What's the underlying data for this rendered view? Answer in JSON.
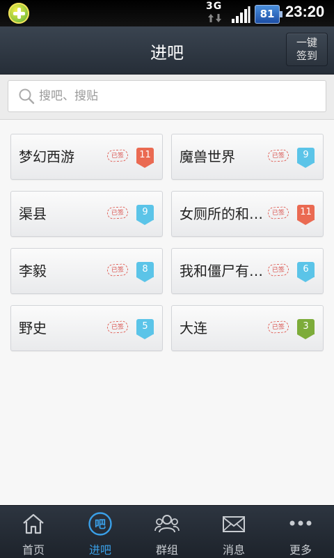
{
  "status_bar": {
    "network": "3G",
    "battery": "81",
    "time": "23:20"
  },
  "header": {
    "title": "进吧",
    "signin_line1": "一键",
    "signin_line2": "签到"
  },
  "search": {
    "placeholder": "搜吧、搜贴"
  },
  "stamp_text": "已签",
  "forums": [
    {
      "name": "梦幻西游",
      "level": "11",
      "badge_color": "#ea6a52"
    },
    {
      "name": "魔兽世界",
      "level": "9",
      "badge_color": "#5bc4e8"
    },
    {
      "name": "渠县",
      "level": "9",
      "badge_color": "#5bc4e8"
    },
    {
      "name": "女厕所的和…",
      "level": "11",
      "badge_color": "#ea6a52"
    },
    {
      "name": "李毅",
      "level": "8",
      "badge_color": "#5bc4e8"
    },
    {
      "name": "我和僵尸有…",
      "level": "6",
      "badge_color": "#5bc4e8"
    },
    {
      "name": "野史",
      "level": "5",
      "badge_color": "#5bc4e8"
    },
    {
      "name": "大连",
      "level": "3",
      "badge_color": "#7dac3a"
    }
  ],
  "tabs": [
    {
      "label": "首页",
      "icon": "home-icon"
    },
    {
      "label": "进吧",
      "icon": "bar-icon",
      "active": true
    },
    {
      "label": "群组",
      "icon": "group-icon"
    },
    {
      "label": "消息",
      "icon": "message-icon"
    },
    {
      "label": "更多",
      "icon": "more-icon"
    }
  ],
  "colors": {
    "accent": "#3aa0e8",
    "header_bg": "#2e3742",
    "stamp": "#e0635a"
  }
}
